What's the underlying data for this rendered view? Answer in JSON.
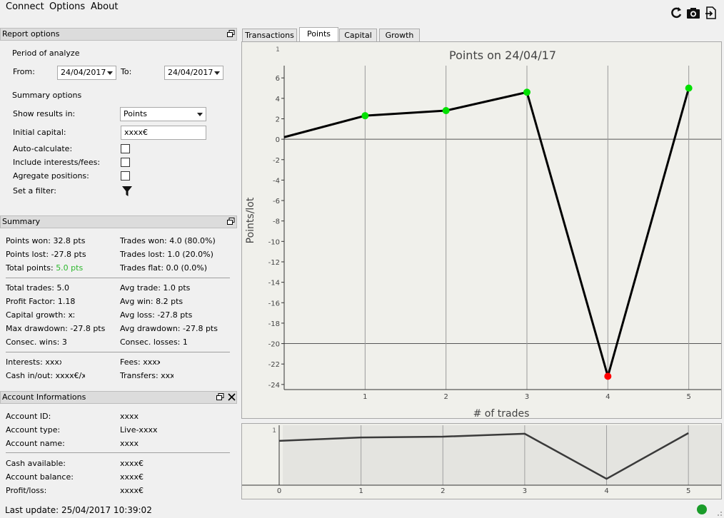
{
  "menu": {
    "connect": "Connect",
    "options": "Options",
    "about": "About"
  },
  "toolbar": {
    "refresh_icon": "refresh-icon",
    "camera_icon": "camera-icon",
    "export_icon": "export-icon"
  },
  "report_options": {
    "title": "Report options",
    "period_label": "Period of analyze",
    "from_label": "From:",
    "from_value": "24/04/2017",
    "to_label": "To:",
    "to_value": "24/04/2017",
    "summary_options_label": "Summary options",
    "show_results_label": "Show results in:",
    "show_results_value": "Points",
    "initial_capital_label": "Initial capital:",
    "initial_capital_value": "xxxx€",
    "auto_calculate_label": "Auto-calculate:",
    "include_fees_label": "Include interests/fees:",
    "aggregate_label": "Agregate positions:",
    "filter_label": "Set a filter:"
  },
  "summary": {
    "title": "Summary",
    "points_won": "Points won: 32.8 pts",
    "trades_won": "Trades won: 4.0 (80.0%)",
    "points_lost": "Points lost: -27.8 pts",
    "trades_lost": "Trades lost: 1.0 (20.0%)",
    "total_points_label": "Total points: ",
    "total_points_value": "5.0 pts",
    "trades_flat": "Trades flat: 0.0 (0.0%)",
    "total_trades": "Total trades: 5.0",
    "avg_trade": "Avg trade: 1.0 pts",
    "profit_factor": "Profit Factor: 1.18",
    "avg_win": "Avg win: 8.2 pts",
    "capital_growth": "Capital growth: xx%",
    "avg_loss": "Avg loss: -27.8 pts",
    "max_drawdown": "Max drawdown: -27.8 pts",
    "avg_drawdown": "Avg drawdown: -27.8 pts",
    "consec_wins": "Consec. wins: 3",
    "consec_losses": "Consec. losses: 1",
    "interests": "Interests: xxxx€",
    "fees": "Fees: xxxx€",
    "cash_inout": "Cash in/out: xxxx€/xxxx€",
    "transfers": "Transfers: xxxx€"
  },
  "account": {
    "title": "Account Informations",
    "id_label": "Account ID:",
    "id_value": "xxxx",
    "type_label": "Account type:",
    "type_value": "Live-xxxx",
    "name_label": "Account name:",
    "name_value": "xxxx",
    "cash_label": "Cash available:",
    "cash_value": "xxxx€",
    "balance_label": "Account balance:",
    "balance_value": "xxxx€",
    "pl_label": "Profit/loss:",
    "pl_value": "xxxx€"
  },
  "tabs": [
    "Transactions",
    "Points",
    "Capital",
    "Growth"
  ],
  "status": {
    "last_update": "Last update: 25/04/2017 10:39:02",
    "connection_color": "#1a9c2a"
  },
  "colors": {
    "accent_green": "#2db82d",
    "point_win": "#00e000",
    "point_loss": "#ff0000"
  },
  "chart_data": {
    "type": "line",
    "title": "Points on 24/04/17",
    "xlabel": "# of trades",
    "ylabel": "Points/lot",
    "x": [
      0,
      1,
      2,
      3,
      4,
      5
    ],
    "values": [
      0.2,
      2.3,
      2.8,
      4.6,
      -23.2,
      5.0
    ],
    "xlim": [
      0,
      5.4
    ],
    "ylim": [
      -24.5,
      7.2
    ],
    "yticks": [
      6,
      4,
      2,
      0,
      -2,
      -4,
      -6,
      -8,
      -10,
      -12,
      -14,
      -16,
      -18,
      -20,
      -22,
      -24
    ],
    "xticks": [
      1,
      2,
      3,
      4,
      5
    ],
    "grid": true,
    "navigator": {
      "xticks": [
        0,
        1,
        2,
        3,
        4,
        5
      ],
      "yticks": [
        1
      ]
    }
  }
}
